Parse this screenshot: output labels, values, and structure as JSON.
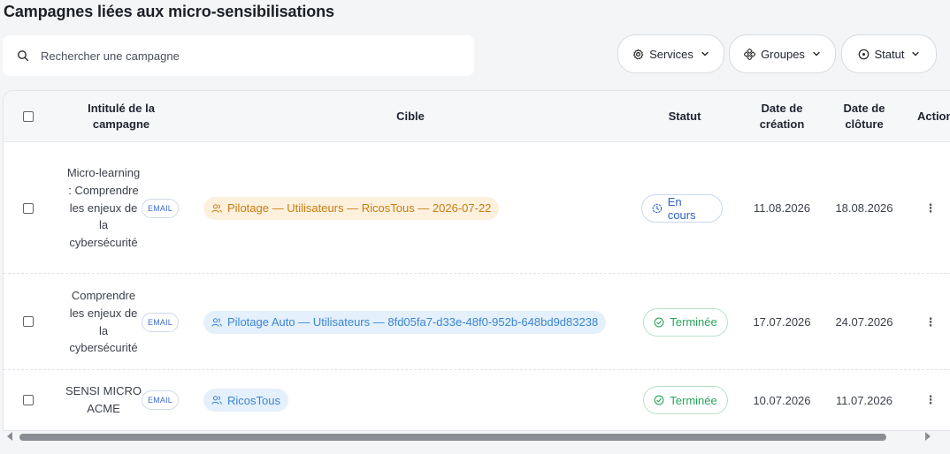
{
  "page": {
    "title": "Campagnes liées aux micro-sensibilisations"
  },
  "search": {
    "placeholder": "Rechercher une campagne"
  },
  "filters": {
    "services": {
      "label": "Services",
      "icon": "gear-icon"
    },
    "groups": {
      "label": "Groupes",
      "icon": "groups-icon"
    },
    "status": {
      "label": "Statut",
      "icon": "status-circle-icon"
    }
  },
  "table": {
    "headers": {
      "name": "Intitulé de la campagne",
      "target": "Cible",
      "status": "Statut",
      "created": "Date de création",
      "closed": "Date de clôture",
      "actions": "Actions"
    },
    "rows": [
      {
        "name": "Micro-learning : Comprendre les enjeux de la cybersécurité",
        "channel": "EMAIL",
        "target": "Pilotage — Utilisateurs — RicosTous — 2026-07-22",
        "target_color": "orange",
        "status": "En cours",
        "status_kind": "in-progress",
        "created": "11.08.2026",
        "closed": "18.08.2026"
      },
      {
        "name": "Comprendre les enjeux de la cybersécurité",
        "channel": "EMAIL",
        "target": "Pilotage Auto — Utilisateurs — 8fd05fa7-d33e-48f0-952b-648bd9d83238",
        "target_color": "blue",
        "status": "Terminée",
        "status_kind": "done",
        "created": "17.07.2026",
        "closed": "24.07.2026"
      },
      {
        "name": "SENSI MICRO ACME",
        "channel": "EMAIL",
        "target": "RicosTous",
        "target_color": "blue",
        "status": "Terminée",
        "status_kind": "done",
        "created": "10.07.2026",
        "closed": "11.07.2026"
      }
    ]
  },
  "colors": {
    "orange_text": "#c97c0f",
    "blue_text": "#3b86d4",
    "green_text": "#27a55a",
    "progress_text": "#2f62c7"
  }
}
